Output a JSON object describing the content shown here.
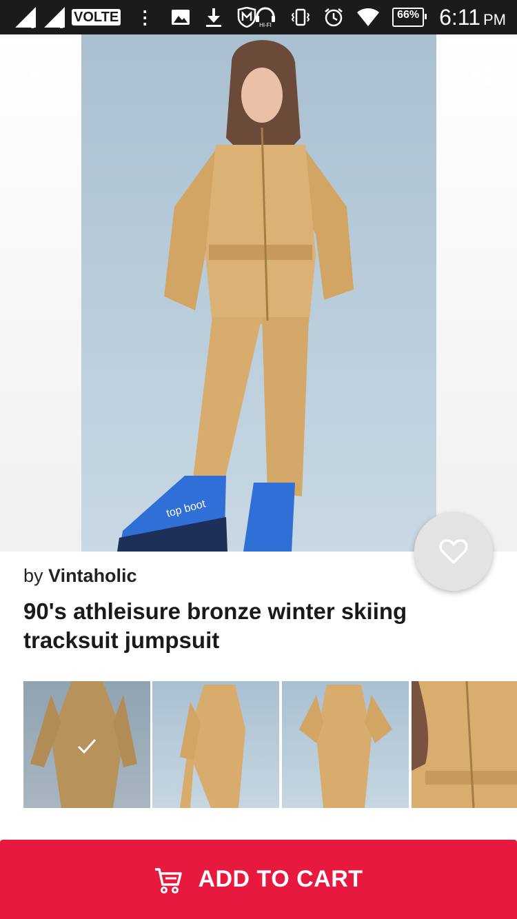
{
  "status_bar": {
    "carrier_badge": "VOLTE",
    "battery": "66%",
    "time": "6:11",
    "ampm": "PM",
    "icons": [
      "signal-1-icon",
      "signal-2-icon",
      "more-dots-icon",
      "image-icon",
      "download-icon",
      "mcafee-icon",
      "hifi-icon",
      "vibrate-icon",
      "alarm-icon",
      "wifi-icon",
      "battery-icon"
    ],
    "sim_labels": [
      "1",
      "2"
    ],
    "hifi_label": "HI-FI"
  },
  "header": {
    "back_icon": "arrow-left-icon",
    "share_icon": "share-icon"
  },
  "product": {
    "seller_prefix": "by",
    "seller_name": "Vintaholic",
    "title": "90's athleisure bronze winter skiing tracksuit jumpsuit",
    "favorite_icon": "heart-outline-icon",
    "boot_text": "top boot"
  },
  "thumbnails": {
    "selected_index": 0,
    "count": 4
  },
  "cart": {
    "label": "ADD TO CART",
    "icon": "cart-icon"
  },
  "colors": {
    "accent": "#e8193f",
    "suit": "#d9ad6e",
    "backdrop": "#b9cddc",
    "status_bar": "#1b1b1b"
  }
}
